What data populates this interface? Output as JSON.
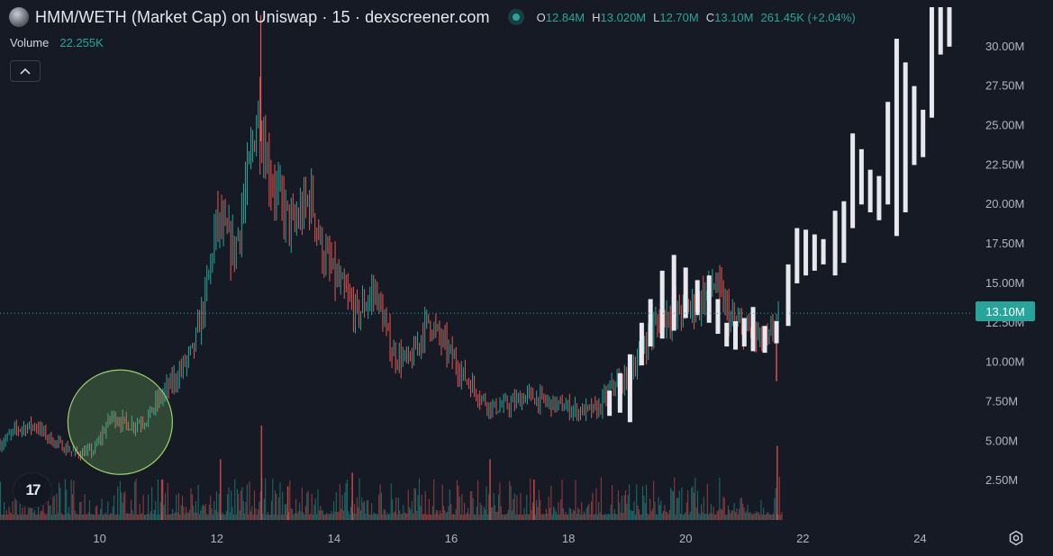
{
  "header": {
    "title": "HMM/WETH (Market Cap) on Uniswap · 15 · dexscreener.com",
    "ohlc": {
      "o_label": "O",
      "o_value": "12.84M",
      "h_label": "H",
      "h_value": "13.020M",
      "l_label": "L",
      "l_value": "12.70M",
      "c_label": "C",
      "c_value": "13.10M",
      "change": "261.45K (+2.04%)"
    }
  },
  "volume": {
    "label": "Volume",
    "value": "22.255K"
  },
  "current_price_label": "13.10M",
  "logo_text": "17",
  "colors": {
    "up": "#26a69a",
    "down": "#ef5350",
    "sparse": "#e6e8ee",
    "background": "#161a25"
  },
  "icons": [
    "token-avatar-icon",
    "live-dot-icon",
    "chevron-up-icon",
    "tradingview-logo-icon",
    "settings-gear-icon"
  ],
  "chart_data": {
    "type": "candlestick",
    "x_unit": "day of month",
    "y_unit": "market cap (USD)",
    "xlim": [
      8.3,
      24.9
    ],
    "ylim": [
      0,
      32500000
    ],
    "x_ticks": [
      10,
      12,
      14,
      16,
      18,
      20,
      22,
      24
    ],
    "x_tick_labels": [
      "10",
      "12",
      "14",
      "16",
      "18",
      "20",
      "22",
      "24"
    ],
    "y_ticks": [
      2500000,
      5000000,
      7500000,
      10000000,
      12500000,
      15000000,
      17500000,
      20000000,
      22500000,
      25000000,
      27500000,
      30000000
    ],
    "y_tick_labels": [
      "2.50M",
      "5.00M",
      "7.50M",
      "10.00M",
      "12.50M",
      "15.00M",
      "17.50M",
      "20.00M",
      "22.50M",
      "25.00M",
      "27.50M",
      "30.00M"
    ],
    "current_price": 13100000,
    "price_trend": {
      "x": [
        8.3,
        8.6,
        8.9,
        9.2,
        9.6,
        9.9,
        10.2,
        10.5,
        10.8,
        11.0,
        11.3,
        11.6,
        11.8,
        12.0,
        12.3,
        12.5,
        12.7,
        12.9,
        13.1,
        13.3,
        13.6,
        13.8,
        14.1,
        14.4,
        14.7,
        15.0,
        15.3,
        15.6,
        15.9,
        16.2,
        16.5,
        16.7,
        17.0,
        17.3,
        17.6,
        17.9,
        18.2,
        18.5,
        18.8,
        19.0,
        19.3,
        19.6,
        19.9,
        20.2,
        20.5,
        20.8,
        21.1,
        21.4,
        21.6
      ],
      "y": [
        4800000,
        5800000,
        6000000,
        5000000,
        4200000,
        4400000,
        6600000,
        6000000,
        6400000,
        7600000,
        9000000,
        10800000,
        14000000,
        19000000,
        17000000,
        21000000,
        26000000,
        22000000,
        20000000,
        18500000,
        20500000,
        17000000,
        14800000,
        13000000,
        14600000,
        10500000,
        10000000,
        12700000,
        11000000,
        9200000,
        7800000,
        7100000,
        7300000,
        7900000,
        7500000,
        7200000,
        6900000,
        7000000,
        8800000,
        8900000,
        11200000,
        13000000,
        13200000,
        13700000,
        15000000,
        12500000,
        11800000,
        11200000,
        13100000
      ]
    },
    "sparse_bars": [
      {
        "x": 18.7,
        "low": 6600000,
        "high": 8200000
      },
      {
        "x": 18.88,
        "low": 6800000,
        "high": 9300000
      },
      {
        "x": 19.05,
        "low": 6200000,
        "high": 10500000
      },
      {
        "x": 19.25,
        "low": 9800000,
        "high": 12500000
      },
      {
        "x": 19.4,
        "low": 11000000,
        "high": 14000000
      },
      {
        "x": 19.6,
        "low": 11500000,
        "high": 15800000
      },
      {
        "x": 19.8,
        "low": 12000000,
        "high": 16800000
      },
      {
        "x": 20.0,
        "low": 12800000,
        "high": 16000000
      },
      {
        "x": 20.2,
        "low": 13000000,
        "high": 15200000
      },
      {
        "x": 20.4,
        "low": 12500000,
        "high": 15500000
      },
      {
        "x": 20.55,
        "low": 11800000,
        "high": 14000000
      },
      {
        "x": 20.7,
        "low": 11000000,
        "high": 12500000
      },
      {
        "x": 20.85,
        "low": 10800000,
        "high": 12600000
      },
      {
        "x": 21.0,
        "low": 11000000,
        "high": 12800000
      },
      {
        "x": 21.15,
        "low": 10700000,
        "high": 13500000
      },
      {
        "x": 21.35,
        "low": 10600000,
        "high": 12300000
      },
      {
        "x": 21.55,
        "low": 11200000,
        "high": 12600000
      },
      {
        "x": 21.75,
        "low": 12300000,
        "high": 16200000
      },
      {
        "x": 21.9,
        "low": 15000000,
        "high": 18500000
      },
      {
        "x": 22.05,
        "low": 15500000,
        "high": 18400000
      },
      {
        "x": 22.2,
        "low": 15800000,
        "high": 18100000
      },
      {
        "x": 22.35,
        "low": 16200000,
        "high": 17800000
      },
      {
        "x": 22.55,
        "low": 15500000,
        "high": 19600000
      },
      {
        "x": 22.7,
        "low": 16300000,
        "high": 20200000
      },
      {
        "x": 22.85,
        "low": 18500000,
        "high": 24500000
      },
      {
        "x": 23.0,
        "low": 20000000,
        "high": 23500000
      },
      {
        "x": 23.15,
        "low": 19500000,
        "high": 22200000
      },
      {
        "x": 23.3,
        "low": 19000000,
        "high": 21800000
      },
      {
        "x": 23.45,
        "low": 20000000,
        "high": 26500000
      },
      {
        "x": 23.6,
        "low": 18000000,
        "high": 30500000
      },
      {
        "x": 23.75,
        "low": 19500000,
        "high": 29000000
      },
      {
        "x": 23.9,
        "low": 22500000,
        "high": 27500000
      },
      {
        "x": 24.05,
        "low": 23000000,
        "high": 26000000
      },
      {
        "x": 24.2,
        "low": 25500000,
        "high": 32500000
      },
      {
        "x": 24.35,
        "low": 29500000,
        "high": 32500000
      },
      {
        "x": 24.5,
        "low": 30000000,
        "high": 32500000
      }
    ],
    "volume_spikes": [
      {
        "x": 12.75,
        "v": 0.7
      },
      {
        "x": 12.05,
        "v": 0.45
      },
      {
        "x": 16.65,
        "v": 0.45
      },
      {
        "x": 21.55,
        "v": 0.55
      },
      {
        "x": 11.05,
        "v": 0.3
      },
      {
        "x": 13.2,
        "v": 0.25
      },
      {
        "x": 14.3,
        "v": 0.35
      },
      {
        "x": 17.4,
        "v": 0.3
      }
    ],
    "highlight_circle": {
      "x": 10.35,
      "y": 6200000
    },
    "grid": false,
    "legend": "none"
  }
}
